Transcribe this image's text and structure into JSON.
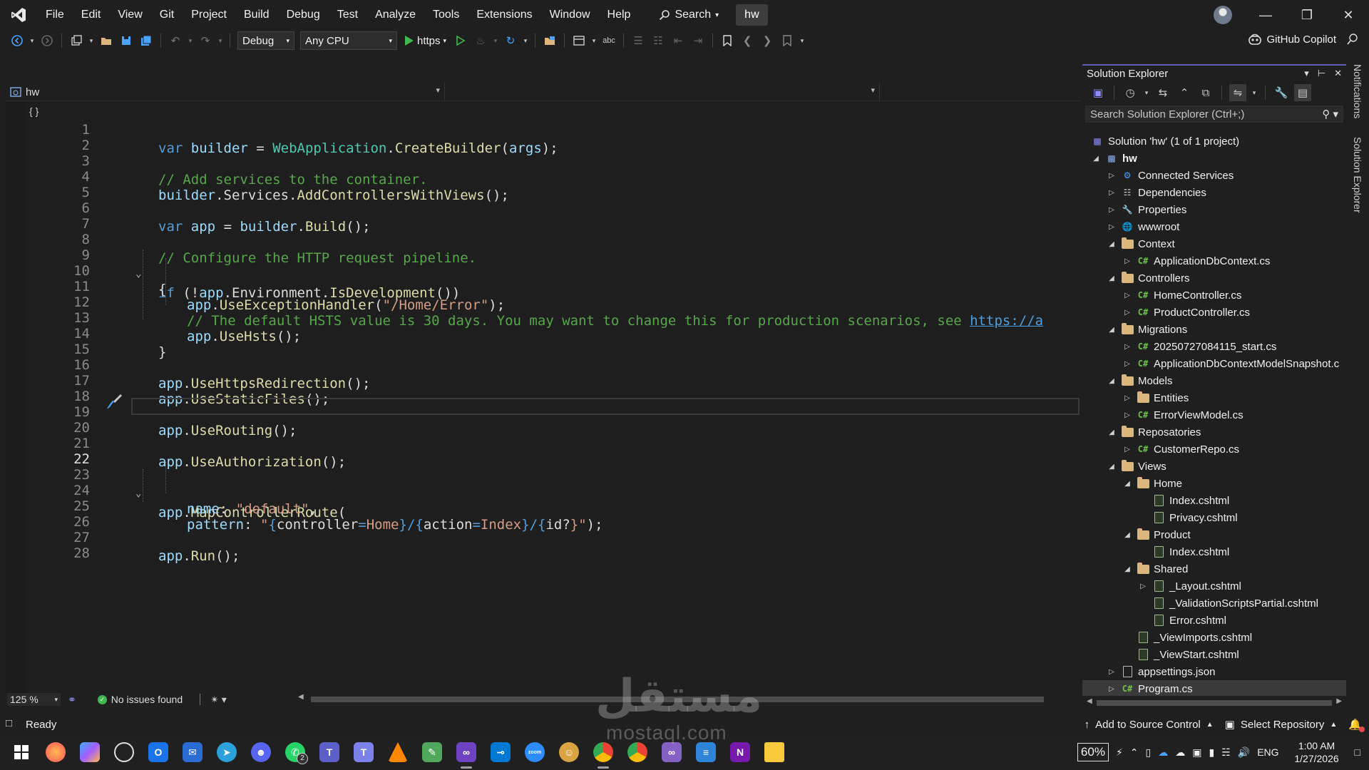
{
  "menu": [
    "File",
    "Edit",
    "View",
    "Git",
    "Project",
    "Build",
    "Debug",
    "Test",
    "Analyze",
    "Tools",
    "Extensions",
    "Window",
    "Help"
  ],
  "search_label": "Search",
  "solution_name": "hw",
  "toolbar": {
    "config": "Debug",
    "platform": "Any CPU",
    "run_target": "https",
    "copilot": "GitHub Copilot"
  },
  "editor": {
    "file_nav": "hw",
    "zoom": "125 %",
    "issues": "No issues found",
    "current_line": 22,
    "lines": [
      {
        "n": "1"
      },
      {
        "n": "2"
      },
      {
        "n": "3"
      },
      {
        "n": "4"
      },
      {
        "n": "5"
      },
      {
        "n": "6"
      },
      {
        "n": "7"
      },
      {
        "n": "8"
      },
      {
        "n": "9"
      },
      {
        "n": "10"
      },
      {
        "n": "11"
      },
      {
        "n": "12"
      },
      {
        "n": "13"
      },
      {
        "n": "14"
      },
      {
        "n": "15"
      },
      {
        "n": "16"
      },
      {
        "n": "17"
      },
      {
        "n": "18"
      },
      {
        "n": "19"
      },
      {
        "n": "20"
      },
      {
        "n": "21"
      },
      {
        "n": "22"
      },
      {
        "n": "23"
      },
      {
        "n": "24"
      },
      {
        "n": "25"
      },
      {
        "n": "26"
      },
      {
        "n": "27"
      },
      {
        "n": "28"
      }
    ],
    "code": {
      "l1": [
        "var",
        "builder",
        "=",
        "WebApplication",
        ".",
        "CreateBuilder",
        "(",
        "args",
        ");"
      ],
      "l3": "// Add services to the container.",
      "l4": [
        "builder",
        ".Services.",
        "AddControllersWithViews",
        "();"
      ],
      "l6": [
        "var",
        "app",
        "=",
        "builder",
        ".",
        "Build",
        "();"
      ],
      "l8": "// Configure the HTTP request pipeline.",
      "l9": [
        "if",
        "(!",
        "app",
        ".Environment.",
        "IsDevelopment",
        "())"
      ],
      "l10": "{",
      "l11": [
        "app",
        ".",
        "UseExceptionHandler",
        "(",
        "\"/Home/Error\"",
        ");"
      ],
      "l12_comment": "// The default HSTS value is 30 days. You may want to change this for production scenarios, see ",
      "l12_url": "https://a",
      "l13": [
        "app",
        ".",
        "UseHsts",
        "();"
      ],
      "l14": "}",
      "l16": [
        "app",
        ".",
        "UseHttpsRedirection",
        "();"
      ],
      "l17": [
        "app",
        ".",
        "UseStaticFiles",
        "();"
      ],
      "l19": [
        "app",
        ".",
        "UseRouting",
        "();"
      ],
      "l21": [
        "app",
        ".",
        "UseAuthorization",
        "();"
      ],
      "l23": [
        "app",
        ".",
        "MapControllerRoute",
        "("
      ],
      "l24": [
        "name",
        ":",
        "\"default\"",
        ","
      ],
      "l25": [
        "pattern",
        ":",
        "\"",
        "{",
        "controller",
        "=",
        "Home",
        "}/{",
        "action",
        "=",
        "Index",
        "}/{",
        "id?",
        "}\"",
        ");"
      ],
      "l27": [
        "app",
        ".",
        "Run",
        "();"
      ]
    }
  },
  "solution_explorer": {
    "title": "Solution Explorer",
    "search_placeholder": "Search Solution Explorer (Ctrl+;)",
    "items": [
      {
        "label": "Solution 'hw' (1 of 1 project)",
        "icon": "solution-icon"
      },
      {
        "label": "hw",
        "icon": "project-icon"
      },
      {
        "label": "Connected Services",
        "icon": "connected-services-icon"
      },
      {
        "label": "Dependencies",
        "icon": "dependencies-icon"
      },
      {
        "label": "Properties",
        "icon": "properties-icon"
      },
      {
        "label": "wwwroot",
        "icon": "globe-icon"
      },
      {
        "label": "Context",
        "icon": "folder-icon"
      },
      {
        "label": "ApplicationDbContext.cs",
        "icon": "csharp-file-icon"
      },
      {
        "label": "Controllers",
        "icon": "folder-icon"
      },
      {
        "label": "HomeController.cs",
        "icon": "csharp-file-icon"
      },
      {
        "label": "ProductController.cs",
        "icon": "csharp-file-icon"
      },
      {
        "label": "Migrations",
        "icon": "folder-icon"
      },
      {
        "label": "20250727084115_start.cs",
        "icon": "csharp-file-icon"
      },
      {
        "label": "ApplicationDbContextModelSnapshot.c",
        "icon": "csharp-file-icon"
      },
      {
        "label": "Models",
        "icon": "folder-icon"
      },
      {
        "label": "Entities",
        "icon": "folder-icon"
      },
      {
        "label": "ErrorViewModel.cs",
        "icon": "csharp-file-icon"
      },
      {
        "label": "Reposatories",
        "icon": "folder-icon"
      },
      {
        "label": "CustomerRepo.cs",
        "icon": "csharp-file-icon"
      },
      {
        "label": "Views",
        "icon": "folder-icon"
      },
      {
        "label": "Home",
        "icon": "folder-icon"
      },
      {
        "label": "Index.cshtml",
        "icon": "razor-file-icon"
      },
      {
        "label": "Privacy.cshtml",
        "icon": "razor-file-icon"
      },
      {
        "label": "Product",
        "icon": "folder-icon"
      },
      {
        "label": "Index.cshtml",
        "icon": "razor-file-icon"
      },
      {
        "label": "Shared",
        "icon": "folder-icon"
      },
      {
        "label": "_Layout.cshtml",
        "icon": "razor-file-icon"
      },
      {
        "label": "_ValidationScriptsPartial.cshtml",
        "icon": "razor-file-icon"
      },
      {
        "label": "Error.cshtml",
        "icon": "razor-file-icon"
      },
      {
        "label": "_ViewImports.cshtml",
        "icon": "razor-file-icon"
      },
      {
        "label": "_ViewStart.cshtml",
        "icon": "razor-file-icon"
      },
      {
        "label": "appsettings.json",
        "icon": "json-file-icon"
      },
      {
        "label": "Program.cs",
        "icon": "csharp-file-icon"
      }
    ]
  },
  "side_tabs": [
    "Notifications",
    "Solution Explorer"
  ],
  "status": {
    "ready": "Ready",
    "add_source_control": "Add to Source Control",
    "select_repository": "Select Repository"
  },
  "taskbar": {
    "battery": "60%",
    "language": "ENG",
    "time": "1:00 AM",
    "date": "1/27/2026",
    "whatsapp_badge": "2"
  },
  "watermark": {
    "text": "مستقل",
    "sub": "mostaql.com"
  },
  "colors": {
    "background": "#1e1e1e",
    "keyword": "#569cd6",
    "identifier": "#9cdcfe",
    "type": "#4ec9b0",
    "method": "#dcdcaa",
    "comment": "#57a64a",
    "string": "#d69d85",
    "accent": "#5e5eb8"
  }
}
